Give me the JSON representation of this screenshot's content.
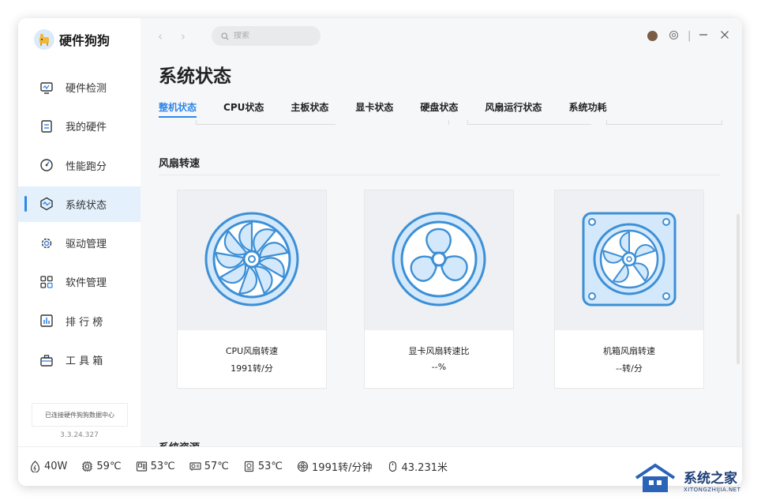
{
  "app": {
    "name": "硬件狗狗",
    "version": "3.3.24.327",
    "status_note": "已连接硬件狗狗数据中心"
  },
  "sidebar": {
    "items": [
      {
        "label": "硬件检测",
        "icon": "monitor-icon",
        "active": false
      },
      {
        "label": "我的硬件",
        "icon": "hardware-list-icon",
        "active": false
      },
      {
        "label": "性能跑分",
        "icon": "gauge-icon",
        "active": false
      },
      {
        "label": "系统状态",
        "icon": "system-status-icon",
        "active": true
      },
      {
        "label": "驱动管理",
        "icon": "gear-icon",
        "active": false
      },
      {
        "label": "软件管理",
        "icon": "apps-grid-icon",
        "active": false
      },
      {
        "label": "排 行 榜",
        "icon": "ranking-icon",
        "active": false
      },
      {
        "label": "工 具 箱",
        "icon": "toolbox-icon",
        "active": false
      }
    ]
  },
  "search": {
    "placeholder": "搜索"
  },
  "page": {
    "title": "系统状态",
    "tabs": [
      {
        "label": "整机状态",
        "active": true
      },
      {
        "label": "CPU状态",
        "active": false
      },
      {
        "label": "主板状态",
        "active": false
      },
      {
        "label": "显卡状态",
        "active": false
      },
      {
        "label": "硬盘状态",
        "active": false
      },
      {
        "label": "风扇运行状态",
        "active": false
      },
      {
        "label": "系统功耗",
        "active": false
      }
    ],
    "fan_section": {
      "title": "风扇转速",
      "cards": [
        {
          "label": "CPU风扇转速",
          "value": "1991转/分",
          "icon": "cpu-fan-icon"
        },
        {
          "label": "显卡风扇转速比",
          "value": "--%",
          "icon": "gpu-fan-icon"
        },
        {
          "label": "机箱风扇转速",
          "value": "--转/分",
          "icon": "case-fan-icon"
        }
      ]
    },
    "next_section_title": "系统资源"
  },
  "statusbar": {
    "items": [
      {
        "icon": "power-icon",
        "value": "40W"
      },
      {
        "icon": "cpu-chip-icon",
        "value": "59℃"
      },
      {
        "icon": "motherboard-icon",
        "value": "53℃"
      },
      {
        "icon": "gpu-card-icon",
        "value": "57℃"
      },
      {
        "icon": "disk-icon",
        "value": "53℃"
      },
      {
        "icon": "fan-icon",
        "value": "1991转/分钟"
      },
      {
        "icon": "mouse-icon",
        "value": "43.231米"
      }
    ]
  },
  "watermark": {
    "text": "系统之家",
    "sub": "XITONGZHIJIA.NET"
  },
  "colors": {
    "accent": "#2f86e8",
    "fan_fill": "#d3e9fb",
    "fan_stroke": "#3d8fd6"
  }
}
